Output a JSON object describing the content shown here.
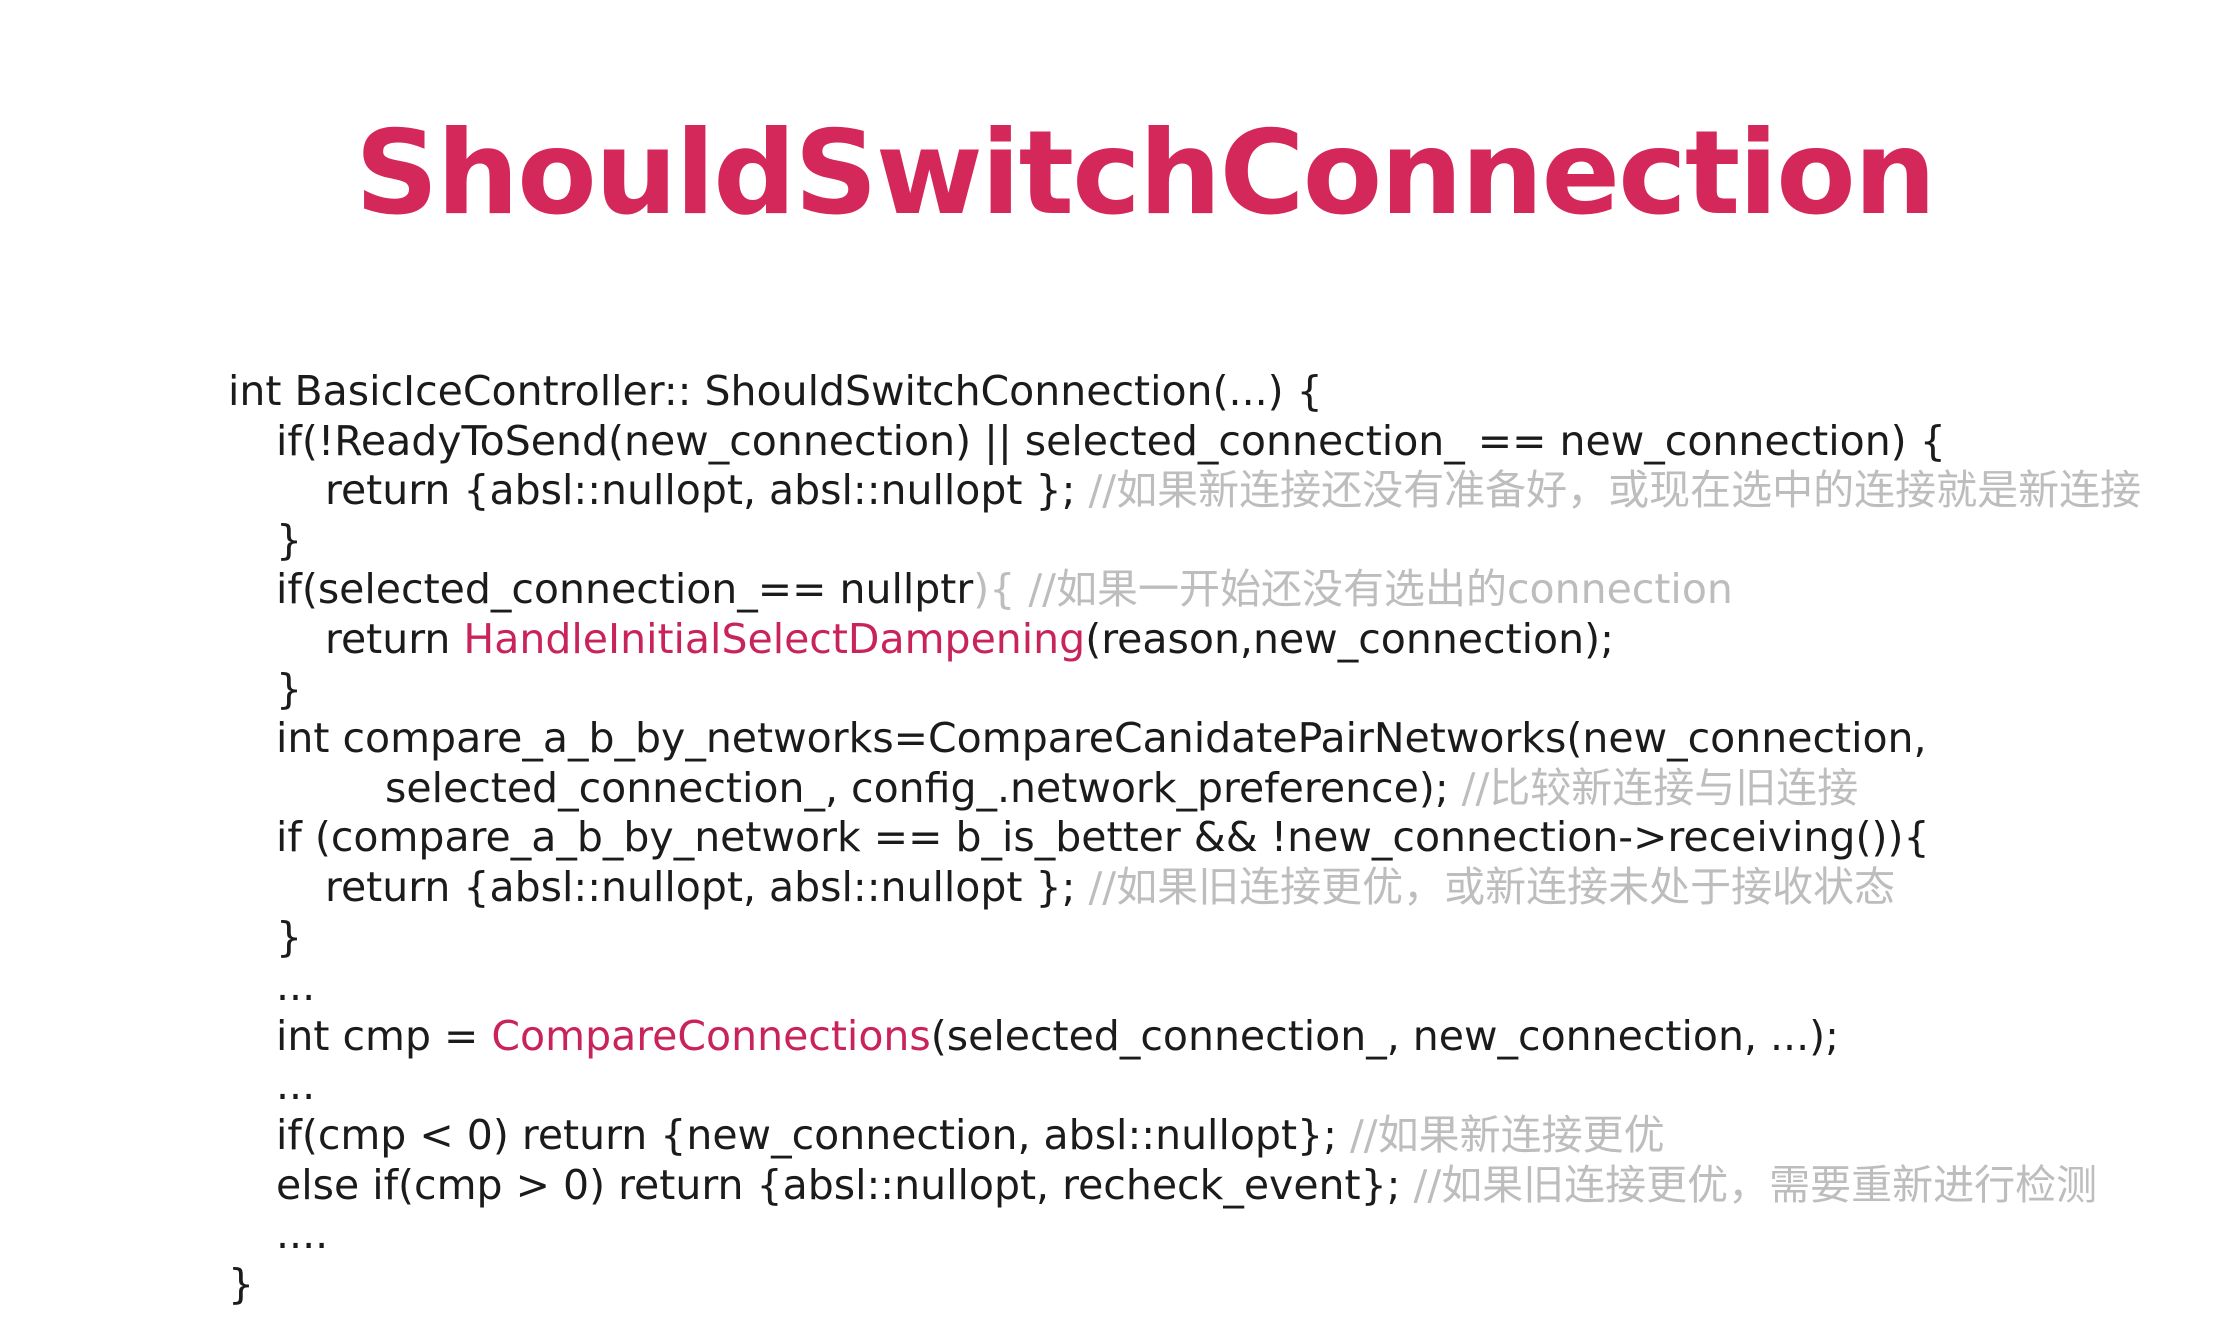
{
  "slide": {
    "title": "ShouldSwitchConnection"
  },
  "code": {
    "lines": [
      {
        "indent": 0,
        "text": "int BasicIceController:: ShouldSwitchConnection(...) {"
      },
      {
        "indent": 1,
        "text": "if(!ReadyToSend(new_connection) || selected_connection_ == new_connection) {"
      },
      {
        "indent": 2,
        "text": "return {absl::nullopt, absl::nullopt }; ",
        "comment": "//如果新连接还没有准备好，或现在选中的连接就是新连接"
      },
      {
        "indent": 1,
        "text": "}"
      },
      {
        "indent": 1,
        "text": "if(selected_connection_== nullptr",
        "comment": "){  //如果一开始还没有选出的connection"
      },
      {
        "indent": 2,
        "pre": "return ",
        "highlight": "HandleInitialSelectDampening",
        "text": "(reason,new_connection);"
      },
      {
        "indent": 1,
        "text": "}"
      },
      {
        "indent": 1,
        "text": "int compare_a_b_by_networks=CompareCanidatePairNetworks(new_connection,"
      },
      {
        "indent": 3,
        "text": "selected_connection_, config_.network_preference); ",
        "comment": "//比较新连接与旧连接"
      },
      {
        "indent": 1,
        "text": "if (compare_a_b_by_network == b_is_better && !new_connection->receiving()){"
      },
      {
        "indent": 2,
        "text": "return {absl::nullopt, absl::nullopt }; ",
        "comment": "//如果旧连接更优，或新连接未处于接收状态"
      },
      {
        "indent": 1,
        "text": "}"
      },
      {
        "indent": 1,
        "text": "..."
      },
      {
        "indent": 1,
        "pre": "int cmp = ",
        "highlight": "CompareConnections",
        "text": "(selected_connection_, new_connection, ...);"
      },
      {
        "indent": 1,
        "text": "..."
      },
      {
        "indent": 1,
        "text": "if(cmp < 0) return {new_connection, absl::nullopt}; ",
        "comment": "//如果新连接更优"
      },
      {
        "indent": 1,
        "text": "else if(cmp > 0) return {absl::nullopt, recheck_event}; ",
        "comment": "//如果旧连接更优，需要重新进行检测"
      },
      {
        "indent": 1,
        "text": "...."
      },
      {
        "indent": 0,
        "text": "}"
      }
    ]
  },
  "colors": {
    "title": "#d4275a",
    "code_text": "#1b1b1b",
    "highlight": "#c9245a",
    "comment": "#bdbdbd",
    "background": "#ffffff"
  }
}
